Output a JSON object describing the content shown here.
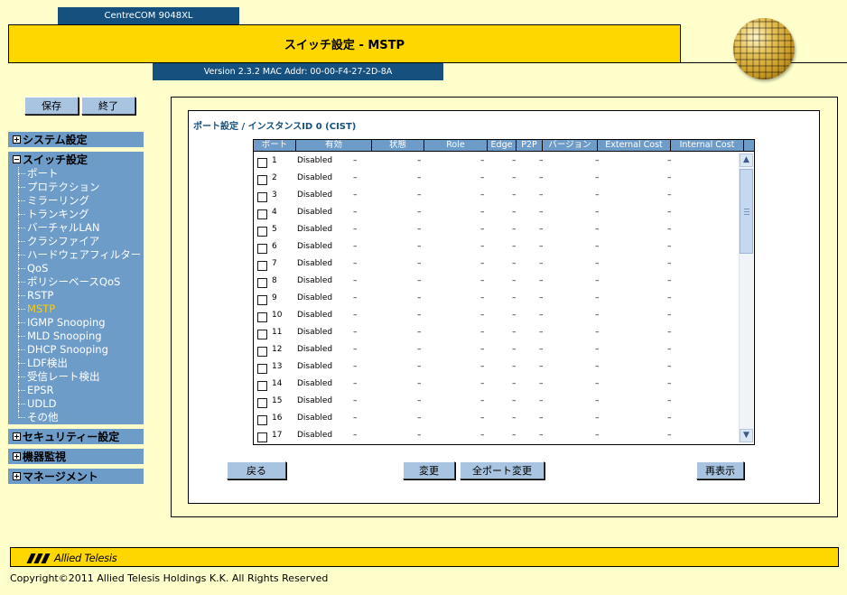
{
  "header": {
    "model": "CentreCOM 9048XL",
    "title": "スイッチ設定 - MSTP",
    "version": "Version 2.3.2 MAC Addr: 00-00-F4-27-2D-8A"
  },
  "toolbar": {
    "save_label": "保存",
    "exit_label": "終了"
  },
  "nav": {
    "system": "システム設定",
    "switch": "スイッチ設定",
    "items": [
      "ポート",
      "プロテクション",
      "ミラーリング",
      "トランキング",
      "バーチャルLAN",
      "クラシファイア",
      "ハードウェアフィルター",
      "QoS",
      "ポリシーベースQoS",
      "RSTP",
      "MSTP",
      "IGMP Snooping",
      "MLD Snooping",
      "DHCP Snooping",
      "LDF検出",
      "受信レート検出",
      "EPSR",
      "UDLD",
      "その他"
    ],
    "active_item": "MSTP",
    "security": "セキュリティー設定",
    "monitor": "機器監視",
    "management": "マネージメント"
  },
  "content": {
    "section_title": "ポート設定 / インスタンスID 0 (CIST)",
    "columns": [
      "ポート",
      "有効",
      "状態",
      "Role",
      "Edge",
      "P2P",
      "バージョン",
      "External Cost",
      "Internal Cost"
    ],
    "rows": [
      {
        "port": "1",
        "enabled": "Disabled",
        "state": "–",
        "role": "–",
        "edge": "–",
        "p2p": "–",
        "version": "–",
        "ext_cost": "–",
        "int_cost": "–"
      },
      {
        "port": "2",
        "enabled": "Disabled",
        "state": "–",
        "role": "–",
        "edge": "–",
        "p2p": "–",
        "version": "–",
        "ext_cost": "–",
        "int_cost": "–"
      },
      {
        "port": "3",
        "enabled": "Disabled",
        "state": "–",
        "role": "–",
        "edge": "–",
        "p2p": "–",
        "version": "–",
        "ext_cost": "–",
        "int_cost": "–"
      },
      {
        "port": "4",
        "enabled": "Disabled",
        "state": "–",
        "role": "–",
        "edge": "–",
        "p2p": "–",
        "version": "–",
        "ext_cost": "–",
        "int_cost": "–"
      },
      {
        "port": "5",
        "enabled": "Disabled",
        "state": "–",
        "role": "–",
        "edge": "–",
        "p2p": "–",
        "version": "–",
        "ext_cost": "–",
        "int_cost": "–"
      },
      {
        "port": "6",
        "enabled": "Disabled",
        "state": "–",
        "role": "–",
        "edge": "–",
        "p2p": "–",
        "version": "–",
        "ext_cost": "–",
        "int_cost": "–"
      },
      {
        "port": "7",
        "enabled": "Disabled",
        "state": "–",
        "role": "–",
        "edge": "–",
        "p2p": "–",
        "version": "–",
        "ext_cost": "–",
        "int_cost": "–"
      },
      {
        "port": "8",
        "enabled": "Disabled",
        "state": "–",
        "role": "–",
        "edge": "–",
        "p2p": "–",
        "version": "–",
        "ext_cost": "–",
        "int_cost": "–"
      },
      {
        "port": "9",
        "enabled": "Disabled",
        "state": "–",
        "role": "–",
        "edge": "–",
        "p2p": "–",
        "version": "–",
        "ext_cost": "–",
        "int_cost": "–"
      },
      {
        "port": "10",
        "enabled": "Disabled",
        "state": "–",
        "role": "–",
        "edge": "–",
        "p2p": "–",
        "version": "–",
        "ext_cost": "–",
        "int_cost": "–"
      },
      {
        "port": "11",
        "enabled": "Disabled",
        "state": "–",
        "role": "–",
        "edge": "–",
        "p2p": "–",
        "version": "–",
        "ext_cost": "–",
        "int_cost": "–"
      },
      {
        "port": "12",
        "enabled": "Disabled",
        "state": "–",
        "role": "–",
        "edge": "–",
        "p2p": "–",
        "version": "–",
        "ext_cost": "–",
        "int_cost": "–"
      },
      {
        "port": "13",
        "enabled": "Disabled",
        "state": "–",
        "role": "–",
        "edge": "–",
        "p2p": "–",
        "version": "–",
        "ext_cost": "–",
        "int_cost": "–"
      },
      {
        "port": "14",
        "enabled": "Disabled",
        "state": "–",
        "role": "–",
        "edge": "–",
        "p2p": "–",
        "version": "–",
        "ext_cost": "–",
        "int_cost": "–"
      },
      {
        "port": "15",
        "enabled": "Disabled",
        "state": "–",
        "role": "–",
        "edge": "–",
        "p2p": "–",
        "version": "–",
        "ext_cost": "–",
        "int_cost": "–"
      },
      {
        "port": "16",
        "enabled": "Disabled",
        "state": "–",
        "role": "–",
        "edge": "–",
        "p2p": "–",
        "version": "–",
        "ext_cost": "–",
        "int_cost": "–"
      },
      {
        "port": "17",
        "enabled": "Disabled",
        "state": "–",
        "role": "–",
        "edge": "–",
        "p2p": "–",
        "version": "–",
        "ext_cost": "–",
        "int_cost": "–"
      }
    ],
    "buttons": {
      "back": "戻る",
      "change": "変更",
      "change_all": "全ポート変更",
      "refresh": "再表示"
    }
  },
  "footer": {
    "logo": "Allied Telesis",
    "copyright": "Copyright©2011 Allied Telesis Holdings K.K. All Rights Reserved"
  }
}
